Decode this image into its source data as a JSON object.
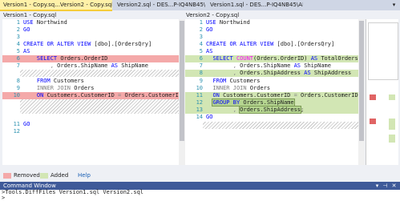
{
  "tabs": [
    {
      "label": "Version1 - Copy.sq...Version2 - Copy.sql",
      "active": true
    },
    {
      "label": "Version2.sql - DES...P-IQ4NB45\\AM (57))",
      "active": false
    },
    {
      "label": "Version1.sql - DES...P-IQ4NB45\\AM (89))",
      "active": false
    }
  ],
  "left_pane": {
    "title": "Version1 - Copy.sql",
    "lines": [
      {
        "n": "1",
        "t": "USE Northwind"
      },
      {
        "n": "2",
        "t": "GO"
      },
      {
        "n": "3",
        "t": ""
      },
      {
        "n": "4",
        "t": "CREATE OR ALTER VIEW [dbo].[OrdersQry]"
      },
      {
        "n": "5",
        "t": "AS"
      },
      {
        "n": "6",
        "t": "    SELECT Orders.OrderID"
      },
      {
        "n": "7",
        "t": "        , Orders.ShipName AS ShipName"
      },
      {
        "n": "8",
        "t": "    FROM Customers"
      },
      {
        "n": "9",
        "t": "    INNER JOIN Orders"
      },
      {
        "n": "10",
        "t": "    ON Customers.CustomerID = Orders.CustomerID;"
      },
      {
        "n": "11",
        "t": "GO"
      },
      {
        "n": "12",
        "t": ""
      }
    ]
  },
  "right_pane": {
    "title": "Version2 - Copy.sql",
    "lines": [
      {
        "n": "1",
        "t": "USE Northwind"
      },
      {
        "n": "2",
        "t": "GO"
      },
      {
        "n": "3",
        "t": ""
      },
      {
        "n": "4",
        "t": "CREATE OR ALTER VIEW [dbo].[OrdersQry]"
      },
      {
        "n": "5",
        "t": "AS"
      },
      {
        "n": "6",
        "t": "  SELECT COUNT(Orders.OrderID) AS TotalOrders"
      },
      {
        "n": "7",
        "t": "        , Orders.ShipName AS ShipName"
      },
      {
        "n": "8",
        "t": "        , Orders.ShipAddress AS ShipAddress"
      },
      {
        "n": "9",
        "t": "  FROM Customers"
      },
      {
        "n": "10",
        "t": "  INNER JOIN Orders"
      },
      {
        "n": "11",
        "t": "  ON Customers.CustomerID = Orders.CustomerID"
      },
      {
        "n": "12",
        "t": "  GROUP BY Orders.ShipName"
      },
      {
        "n": "13",
        "t": "        , Orders.ShipAddress;"
      },
      {
        "n": "14",
        "t": "GO"
      }
    ]
  },
  "legend": {
    "removed_label": "Removed",
    "added_label": "Added",
    "help_label": "Help",
    "removed_color": "#f4a9a9",
    "added_color": "#d2e6b4"
  },
  "command_window": {
    "title": "Command Window",
    "command": ">Tools.DiffFiles Version1.sql Version2.sql",
    "prompt": ">"
  },
  "icons": {
    "pin": "pin-icon",
    "close": "close-icon",
    "dropdown": "chevron-down-icon"
  }
}
